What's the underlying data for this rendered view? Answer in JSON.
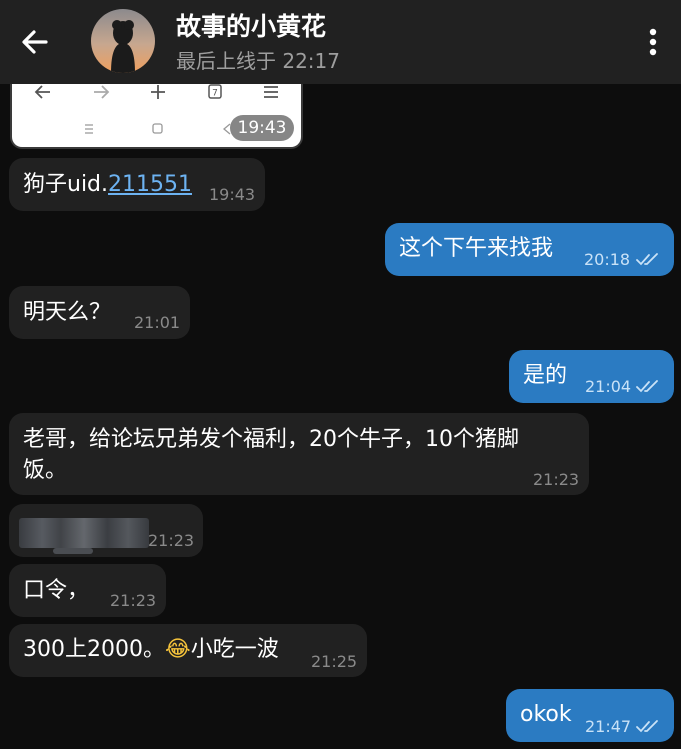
{
  "header": {
    "title": "故事的小黄花",
    "status": "最后上线于 22:17"
  },
  "screenshot_attachment": {
    "toolbar_icons": [
      "back-arrow-icon",
      "forward-arrow-icon",
      "plus-icon",
      "tabs-icon",
      "menu-icon"
    ],
    "tab_count": "7",
    "time": "19:43"
  },
  "messages": [
    {
      "dir": "in",
      "prefix": "狗子uid.",
      "link": "211551",
      "time": "19:43"
    },
    {
      "dir": "out",
      "text": "这个下午来找我",
      "time": "20:18"
    },
    {
      "dir": "in",
      "text": "明天么？",
      "time": "21:01"
    },
    {
      "dir": "out",
      "text": "是的",
      "time": "21:04"
    },
    {
      "dir": "in",
      "line1": "老哥，给论坛兄弟发个福利，20个牛子，10个猪脚",
      "line2": "饭。",
      "time": "21:23"
    },
    {
      "dir": "in",
      "redacted": true,
      "time": "21:23"
    },
    {
      "dir": "in",
      "text": "口令，",
      "time": "21:23"
    },
    {
      "dir": "in",
      "part1": "300上2000。",
      "emoji": "😂",
      "part2": "小吃一波",
      "time": "21:25"
    },
    {
      "dir": "out",
      "text": "okok",
      "time": "21:47"
    }
  ],
  "colors": {
    "background": "#0d0d0d",
    "header": "#212121",
    "incoming": "#212121",
    "outgoing": "#2b7bc2",
    "link": "#6db3f2"
  }
}
